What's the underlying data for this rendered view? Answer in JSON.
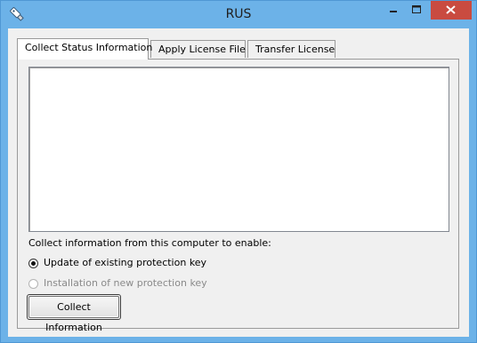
{
  "window": {
    "title": "RUS"
  },
  "tabs": [
    {
      "label": "Collect Status Information",
      "active": true
    },
    {
      "label": "Apply License File",
      "active": false
    },
    {
      "label": "Transfer License",
      "active": false
    }
  ],
  "collect": {
    "status_text": "",
    "instruction": "Collect information from this computer to enable:",
    "options": [
      {
        "label": "Update of existing protection key",
        "checked": true,
        "enabled": true
      },
      {
        "label": "Installation of new protection key",
        "checked": false,
        "enabled": false
      }
    ],
    "button_label": "Collect Information"
  },
  "colors": {
    "titlebar": "#6cb2e8",
    "close_button": "#c94b40",
    "client": "#f0f0f0"
  }
}
